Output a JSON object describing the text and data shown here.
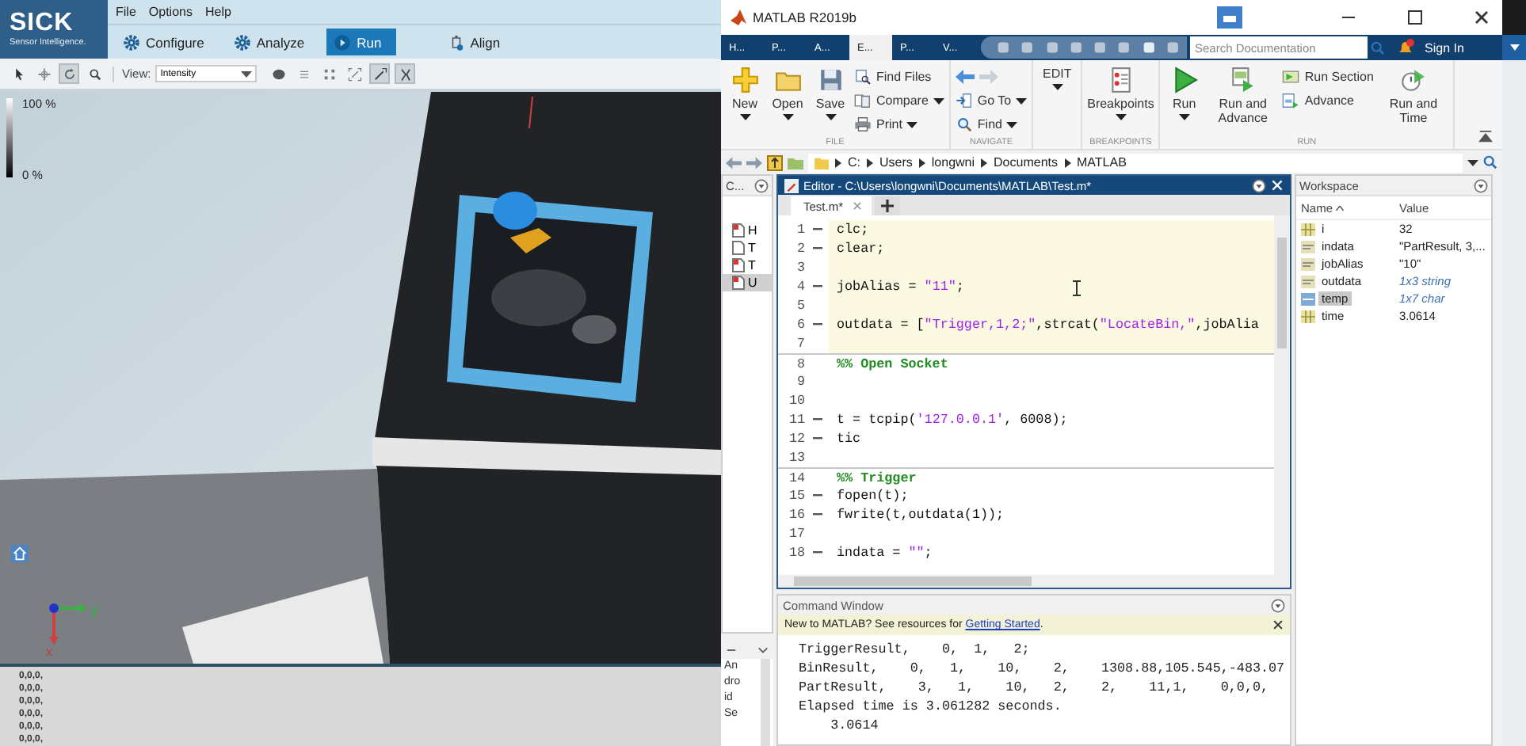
{
  "sick": {
    "logo": "SICK",
    "tagline": "Sensor Intelligence.",
    "menu": [
      "File",
      "Options",
      "Help"
    ],
    "modes": [
      {
        "label": "Configure",
        "selected": false
      },
      {
        "label": "Analyze",
        "selected": false
      },
      {
        "label": "Run",
        "selected": true
      },
      {
        "label": "Align",
        "selected": false
      }
    ],
    "tools": [
      {
        "selected": false
      },
      {
        "selected": false
      },
      {
        "selected": true
      },
      {
        "selected": false
      }
    ],
    "view": {
      "label": "View:",
      "value": "Intensity"
    },
    "tools_right": [
      {
        "selected": false
      },
      {
        "selected": false
      },
      {
        "selected": false
      },
      {
        "selected": false
      },
      {
        "selected": true
      },
      {
        "selected": true
      }
    ],
    "colorbar": {
      "max_label": "100 %",
      "min_label": "0 %"
    },
    "axes": {
      "y_label": "y",
      "x_label": "x"
    },
    "log_lines": [
      "0,0,0,",
      "0,0,0,",
      "0,0,0,",
      "0,0,0,",
      "0,0,0,",
      "0,0,0,"
    ]
  },
  "matlab": {
    "title": "MATLAB R2019b",
    "tabs": [
      {
        "label": "H...",
        "selected": false
      },
      {
        "label": "P...",
        "selected": false
      },
      {
        "label": "A...",
        "selected": false
      },
      {
        "label": "E...",
        "selected": true
      },
      {
        "label": "P...",
        "selected": false
      },
      {
        "label": "V...",
        "selected": false
      }
    ],
    "search": {
      "placeholder": "Search Documentation"
    },
    "sign_in": "Sign In",
    "ribbon": [
      {
        "title": "FILE",
        "items": [
          {
            "kind": "large",
            "label": "New",
            "dropdown": true
          },
          {
            "kind": "large",
            "label": "Open",
            "dropdown": true
          },
          {
            "kind": "large",
            "label": "Save",
            "dropdown": true
          },
          {
            "kind": "stack",
            "items": [
              {
                "kind": "button",
                "label": "Find Files",
                "dropdown": false
              },
              {
                "kind": "button",
                "label": "Compare",
                "dropdown": true
              },
              {
                "kind": "button",
                "label": "Print",
                "dropdown": true
              }
            ]
          }
        ]
      },
      {
        "title": "NAVIGATE",
        "items": [
          {
            "kind": "stack",
            "items": [
              {
                "kind": "arrows"
              },
              {
                "kind": "button",
                "label": "Go To",
                "dropdown": true
              },
              {
                "kind": "button",
                "label": "Find",
                "dropdown": true
              }
            ]
          }
        ]
      },
      {
        "items": [
          {
            "kind": "large",
            "label": "EDIT",
            "dropdown": true
          }
        ]
      },
      {
        "title": "BREAKPOINTS",
        "items": [
          {
            "kind": "large",
            "label": "Breakpoints",
            "dropdown": true
          }
        ]
      },
      {
        "title": "RUN",
        "items": [
          {
            "kind": "large",
            "label": "Run",
            "dropdown": true
          },
          {
            "kind": "large",
            "label": "Run and Advance",
            "dropdown": false
          },
          {
            "kind": "stack",
            "items": [
              {
                "kind": "button",
                "label": "Run Section",
                "dropdown": false
              },
              {
                "kind": "button",
                "label": "Advance",
                "dropdown": false
              }
            ]
          },
          {
            "kind": "large",
            "label": "Run and Time",
            "dropdown": false
          }
        ]
      }
    ],
    "address": [
      "C:",
      "Users",
      "longwni",
      "Documents",
      "MATLAB"
    ],
    "folder": {
      "title": "C...",
      "items": [
        {
          "label": "H",
          "kind": "mfile",
          "selected": false
        },
        {
          "label": "T",
          "kind": "file",
          "selected": false
        },
        {
          "label": "T",
          "kind": "mfile",
          "selected": false
        },
        {
          "label": "U",
          "kind": "mfile",
          "selected": true
        }
      ]
    },
    "details": {
      "text": "Android Se"
    },
    "editor": {
      "title": "Editor - C:\\Users\\longwni\\Documents\\MATLAB\\Test.m*",
      "tabs": [
        {
          "label": "Test.m*",
          "selected": true
        }
      ],
      "lines": [
        {
          "number": "1",
          "executable": true,
          "in_cell": true,
          "cell_start": false,
          "tokens": [
            {
              "kind": "code",
              "text": "clc;"
            }
          ]
        },
        {
          "number": "2",
          "executable": true,
          "in_cell": true,
          "cell_start": false,
          "tokens": [
            {
              "kind": "code",
              "text": "clear;"
            }
          ]
        },
        {
          "number": "3",
          "executable": false,
          "in_cell": true,
          "cell_start": false
        },
        {
          "number": "4",
          "executable": true,
          "in_cell": true,
          "cell_start": false,
          "tokens": [
            {
              "kind": "code",
              "text": "jobAlias = "
            },
            {
              "kind": "string",
              "text": "\"11\""
            },
            {
              "kind": "code",
              "text": ";"
            }
          ]
        },
        {
          "number": "5",
          "executable": false,
          "in_cell": true,
          "cell_start": false
        },
        {
          "number": "6",
          "executable": true,
          "in_cell": true,
          "cell_start": false,
          "tokens": [
            {
              "kind": "code",
              "text": "outdata = ["
            },
            {
              "kind": "string",
              "text": "\"Trigger,1,2;\""
            },
            {
              "kind": "code",
              "text": ",strcat("
            },
            {
              "kind": "string",
              "text": "\"LocateBin,\""
            },
            {
              "kind": "code",
              "text": ",jobAlia"
            }
          ]
        },
        {
          "number": "7",
          "executable": false,
          "in_cell": true,
          "cell_start": false
        },
        {
          "number": "8",
          "executable": false,
          "in_cell": false,
          "cell_start": true,
          "tokens": [
            {
              "kind": "comment",
              "text": "%% Open Socket"
            }
          ]
        },
        {
          "number": "9",
          "executable": false,
          "in_cell": false,
          "cell_start": false
        },
        {
          "number": "10",
          "executable": false,
          "in_cell": false,
          "cell_start": false
        },
        {
          "number": "11",
          "executable": true,
          "in_cell": false,
          "cell_start": false,
          "tokens": [
            {
              "kind": "code",
              "text": "t = tcpip("
            },
            {
              "kind": "string",
              "text": "'127.0.0.1'"
            },
            {
              "kind": "code",
              "text": ", 6008);"
            }
          ]
        },
        {
          "number": "12",
          "executable": true,
          "in_cell": false,
          "cell_start": false,
          "tokens": [
            {
              "kind": "code",
              "text": "tic"
            }
          ]
        },
        {
          "number": "13",
          "executable": false,
          "in_cell": false,
          "cell_start": false
        },
        {
          "number": "14",
          "executable": false,
          "in_cell": false,
          "cell_start": true,
          "tokens": [
            {
              "kind": "comment",
              "text": "%% Trigger"
            }
          ]
        },
        {
          "number": "15",
          "executable": true,
          "in_cell": false,
          "cell_start": false,
          "tokens": [
            {
              "kind": "code",
              "text": "fopen(t);"
            }
          ]
        },
        {
          "number": "16",
          "executable": true,
          "in_cell": false,
          "cell_start": false,
          "tokens": [
            {
              "kind": "code",
              "text": "fwrite(t,outdata(1));"
            }
          ]
        },
        {
          "number": "17",
          "executable": false,
          "in_cell": false,
          "cell_start": false
        },
        {
          "number": "18",
          "executable": true,
          "in_cell": false,
          "cell_start": false,
          "tokens": [
            {
              "kind": "code",
              "text": "indata = "
            },
            {
              "kind": "string",
              "text": "\"\""
            },
            {
              "kind": "code",
              "text": ";"
            }
          ]
        }
      ]
    },
    "command": {
      "title": "Command Window",
      "banner": {
        "before": "New to MATLAB? See resources for ",
        "link": "Getting Started",
        "after": "."
      },
      "output": [
        "TriggerResult,    0,  1,   2;",
        "BinResult,    0,   1,    10,    2,    1308.88,105.545,-483.07",
        "PartResult,    3,   1,    10,   2,    2,    11,1,    0,0,0,",
        "Elapsed time is 3.061282 seconds.",
        "    3.0614"
      ]
    },
    "workspace": {
      "title": "Workspace",
      "columns": [
        "Name",
        "Value"
      ],
      "rows": [
        {
          "name": "i",
          "value": "32",
          "kind": "numeric",
          "summary": false,
          "selected": false
        },
        {
          "name": "indata",
          "value": "\"PartResult, 3,...",
          "kind": "text",
          "summary": false,
          "selected": false
        },
        {
          "name": "jobAlias",
          "value": "\"10\"",
          "kind": "text",
          "summary": false,
          "selected": false
        },
        {
          "name": "outdata",
          "value": "1x3 string",
          "kind": "text",
          "summary": true,
          "selected": false
        },
        {
          "name": "temp",
          "value": "1x7 char",
          "kind": "char",
          "summary": true,
          "selected": true
        },
        {
          "name": "time",
          "value": "3.0614",
          "kind": "numeric",
          "summary": false,
          "selected": false
        }
      ]
    }
  }
}
